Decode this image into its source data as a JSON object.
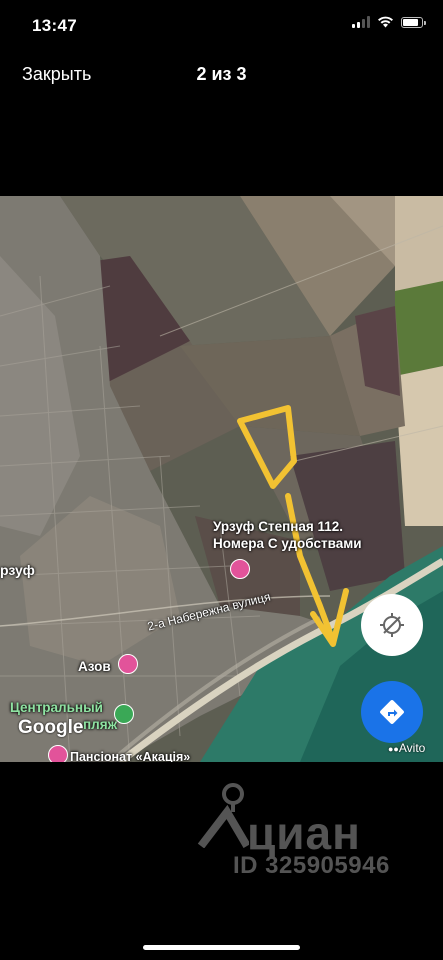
{
  "status_bar": {
    "time": "13:47"
  },
  "nav": {
    "close_label": "Закрыть",
    "counter": "2 из 3"
  },
  "map": {
    "labels": {
      "place_name": "Урзуф Степная 112.",
      "place_desc": "Номера С удобствами",
      "town_partial": "рзуф",
      "street": "2-а Набережна вулиця",
      "azov": "Азов",
      "central_line1": "Центральный",
      "central_line2": "пляж",
      "pension": "Пансіонат «Акація»"
    },
    "google_logo": "Google",
    "avito_watermark": "Avito",
    "locate_icon": "crosshair-icon",
    "directions_icon": "directions-icon",
    "colors": {
      "route_arrow": "#f2c232",
      "pin_pink": "#e2539a",
      "pin_green": "#3aa856",
      "directions_blue": "#1a73e8"
    }
  },
  "watermark": {
    "brand": "циан",
    "id": "ID 325905946"
  }
}
